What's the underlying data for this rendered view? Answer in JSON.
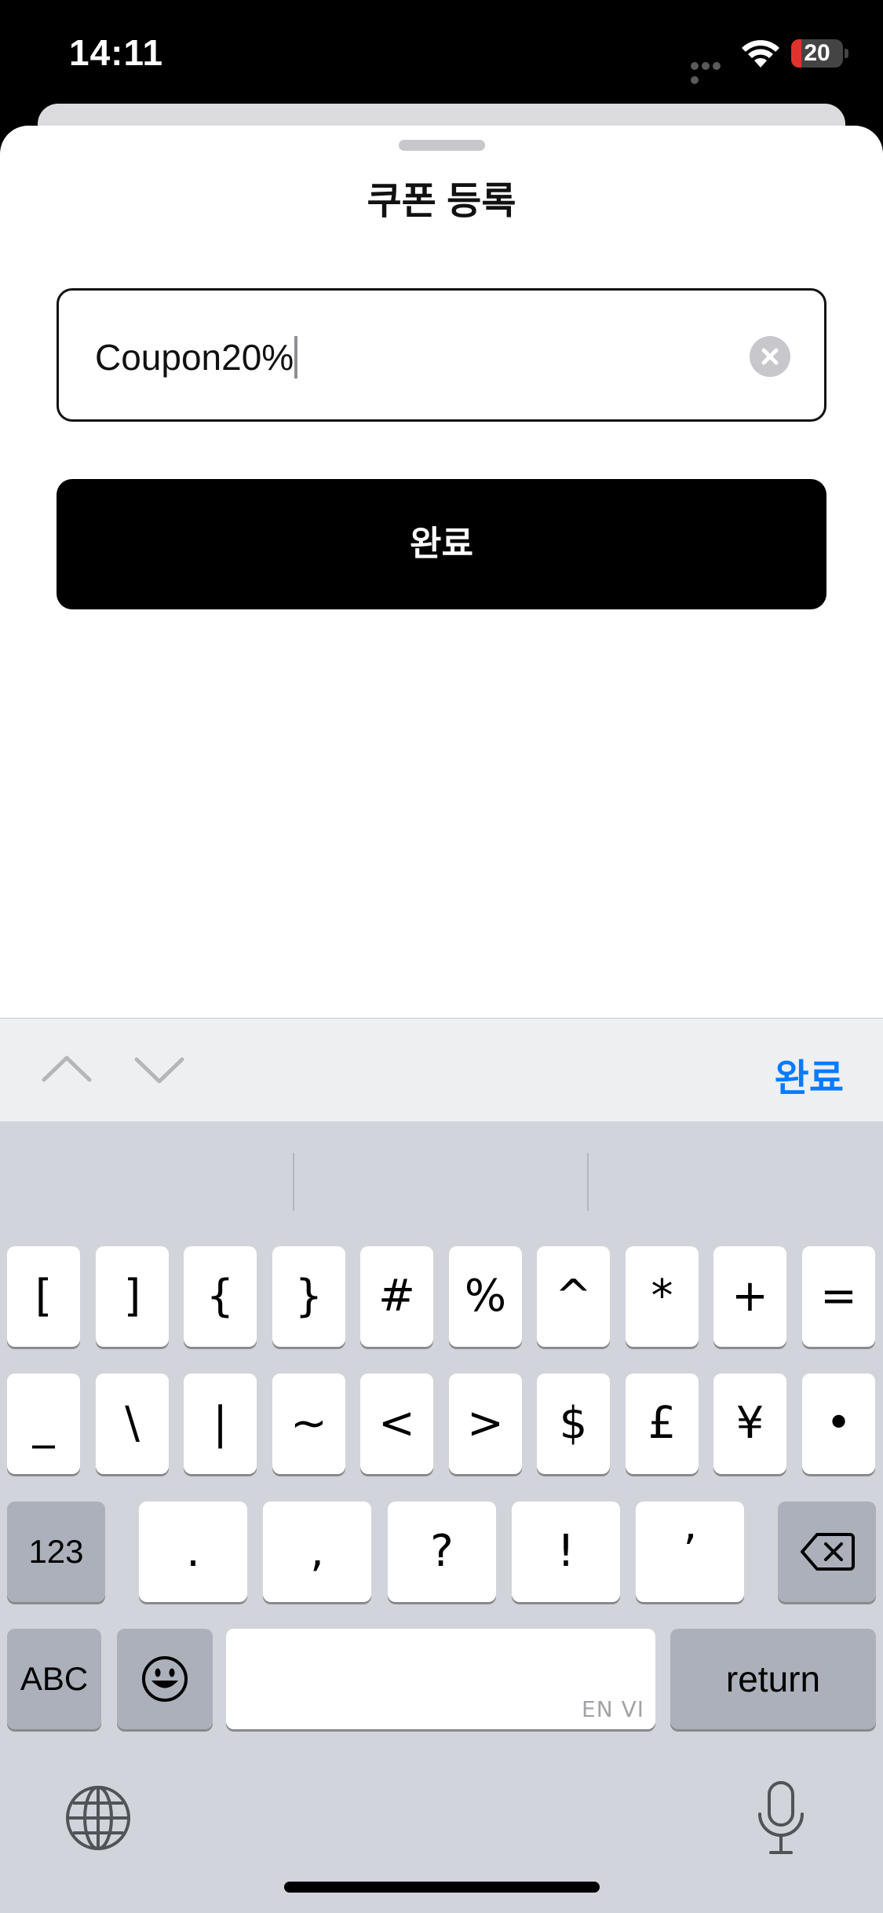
{
  "status_bar": {
    "time": "14:11",
    "battery_level": "20",
    "battery_fraction": 0.2,
    "battery_color": "#e0322e"
  },
  "sheet": {
    "title": "쿠폰 등록",
    "coupon_input_value": "Coupon20%",
    "submit_label": "완료",
    "clear_icon": "clear-circle-icon"
  },
  "toolbar": {
    "prev_icon": "chevron-up-icon",
    "next_icon": "chevron-down-icon",
    "done_label": "완료",
    "done_color": "#0a7aff"
  },
  "keyboard": {
    "row1": [
      "[",
      "]",
      "{",
      "}",
      "#",
      "%",
      "^",
      "*",
      "+",
      "="
    ],
    "row2": [
      "_",
      "\\",
      "|",
      "~",
      "<",
      ">",
      "$",
      "£",
      "¥",
      "•"
    ],
    "row3": {
      "mode_key": "123",
      "keys": [
        ".",
        ",",
        "?",
        "!",
        "’"
      ],
      "delete_icon": "backspace-icon"
    },
    "row4": {
      "abc_key": "ABC",
      "emoji_icon": "emoji-icon",
      "space_lang": "EN VI",
      "return_key": "return"
    },
    "globe_icon": "globe-icon",
    "mic_icon": "microphone-icon"
  }
}
